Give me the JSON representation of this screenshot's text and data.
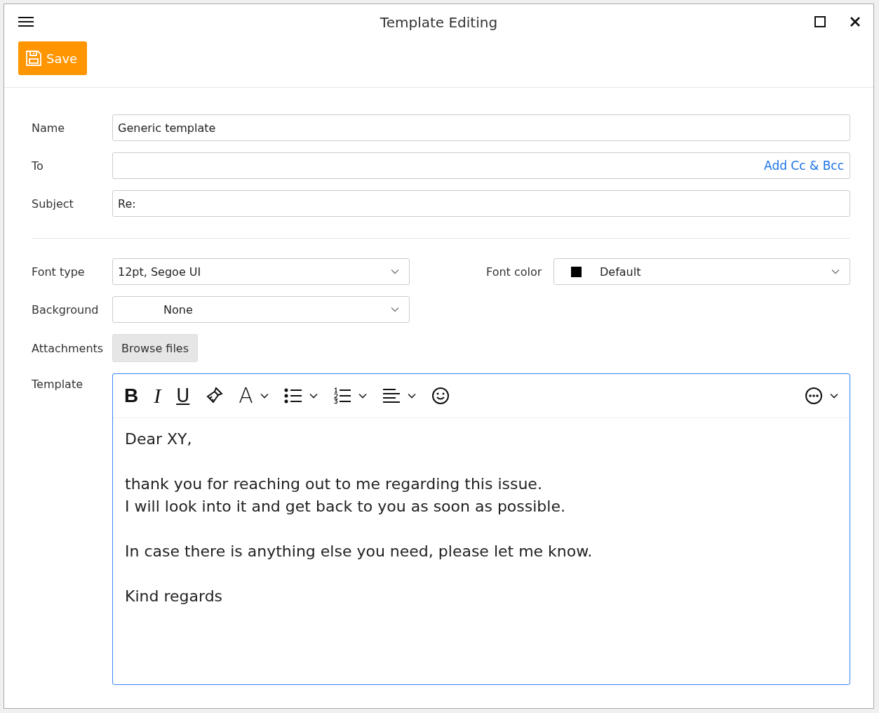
{
  "window": {
    "title": "Template Editing"
  },
  "toolbar": {
    "save_label": "Save"
  },
  "fields": [
    {
      "label": "Name",
      "value": "Generic template"
    },
    {
      "label": "To",
      "link": "Add Cc & Bcc"
    },
    {
      "label": "Subject",
      "value": "Re:"
    }
  ],
  "font_type": {
    "label": "Font type",
    "value": "12pt, Segoe UI"
  },
  "font_color": {
    "label": "Font color",
    "value": "Default"
  },
  "background": {
    "label": "Background",
    "value": "None"
  },
  "attachments": {
    "label": "Attachments",
    "button": "Browse files"
  },
  "template": {
    "label": "Template",
    "tools": [
      {
        "kind": "bold",
        "glyph": "B",
        "dropdown": false
      },
      {
        "kind": "italic",
        "glyph": "I",
        "dropdown": false
      },
      {
        "kind": "underline",
        "glyph": "U",
        "dropdown": false
      },
      {
        "kind": "brush",
        "dropdown": false
      },
      {
        "kind": "font",
        "glyph": "A",
        "dropdown": true
      },
      {
        "kind": "bullets",
        "dropdown": true
      },
      {
        "kind": "numbering",
        "dropdown": true
      },
      {
        "kind": "align",
        "dropdown": true
      },
      {
        "kind": "emoji",
        "dropdown": false
      },
      {
        "kind": "more",
        "dropdown": true
      }
    ],
    "body": [
      [
        "Dear XY,"
      ],
      [
        "thank you for reaching out to me regarding this issue.",
        "I will look into it and get back to you as soon as possible."
      ],
      [
        "In case there is anything else you need, please let me know."
      ],
      [
        "Kind regards"
      ]
    ]
  }
}
